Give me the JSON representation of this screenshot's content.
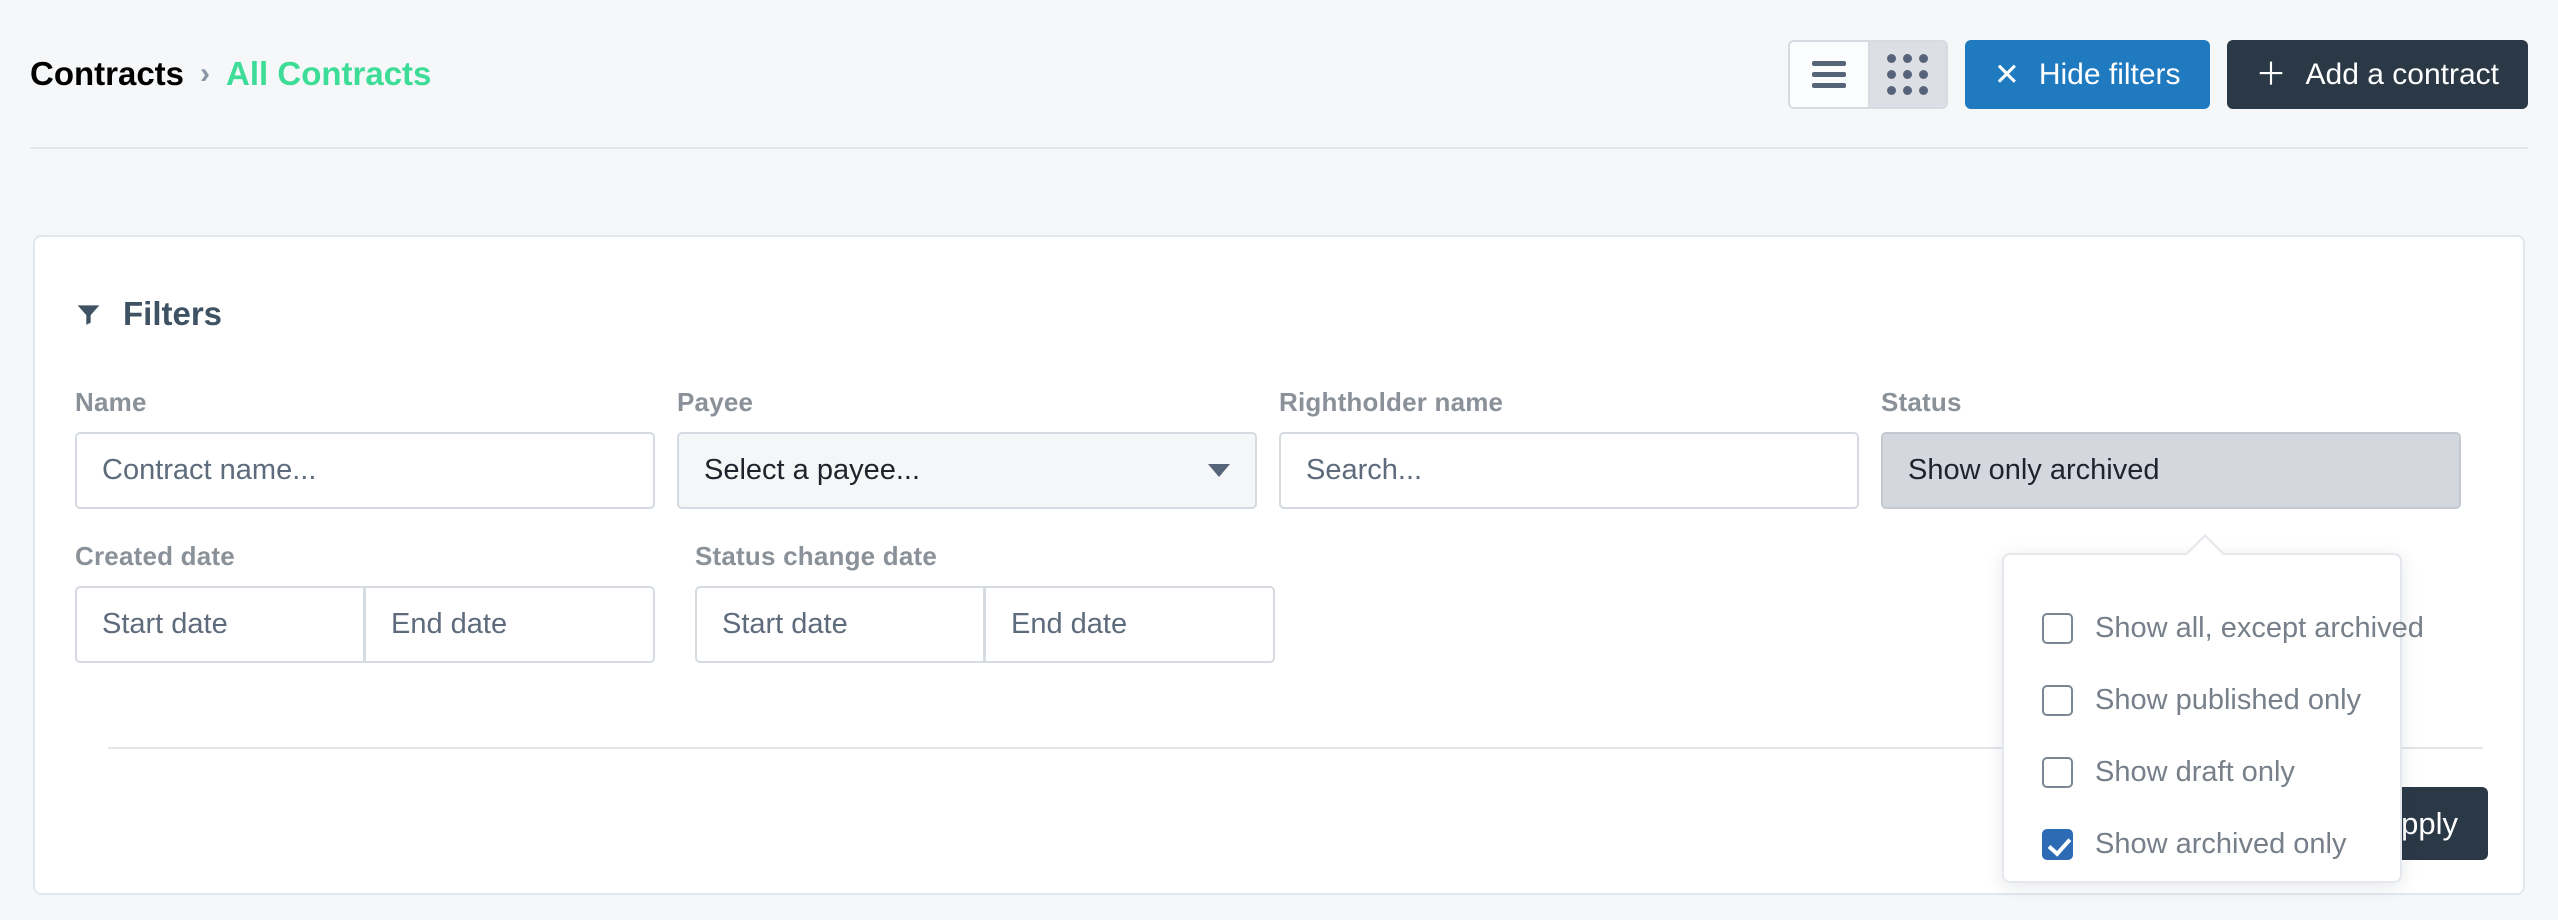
{
  "breadcrumb": {
    "root": "Contracts",
    "separator": "›",
    "current": "All Contracts"
  },
  "toolbar": {
    "view_list_icon": "list-view-icon",
    "view_grid_icon": "grid-view-icon",
    "hide_filters_glyph": "✕",
    "hide_filters_label": "Hide filters",
    "add_contract_glyph": "＋",
    "add_contract_label": "Add a contract",
    "accent_blue": "#1f7ac0",
    "accent_dark": "#2b3947"
  },
  "filters": {
    "title": "Filters",
    "title_icon": "funnel-icon",
    "name": {
      "label": "Name",
      "placeholder": "Contract name...",
      "value": ""
    },
    "payee": {
      "label": "Payee",
      "selected": "Select a payee..."
    },
    "rightholder": {
      "label": "Rightholder name",
      "placeholder": "Search...",
      "value": ""
    },
    "status": {
      "label": "Status",
      "selected": "Show only archived",
      "options": [
        {
          "label": "Show all, except archived",
          "checked": false
        },
        {
          "label": "Show published only",
          "checked": false
        },
        {
          "label": "Show draft only",
          "checked": false
        },
        {
          "label": "Show archived only",
          "checked": true
        }
      ],
      "checked_color": "#2d6cb5"
    },
    "created_date": {
      "label": "Created date",
      "start_placeholder": "Start date",
      "end_placeholder": "End date",
      "start_value": "",
      "end_value": ""
    },
    "status_change_date": {
      "label": "Status change date",
      "start_placeholder": "Start date",
      "end_placeholder": "End date",
      "start_value": "",
      "end_value": ""
    },
    "apply_label": "Apply"
  }
}
